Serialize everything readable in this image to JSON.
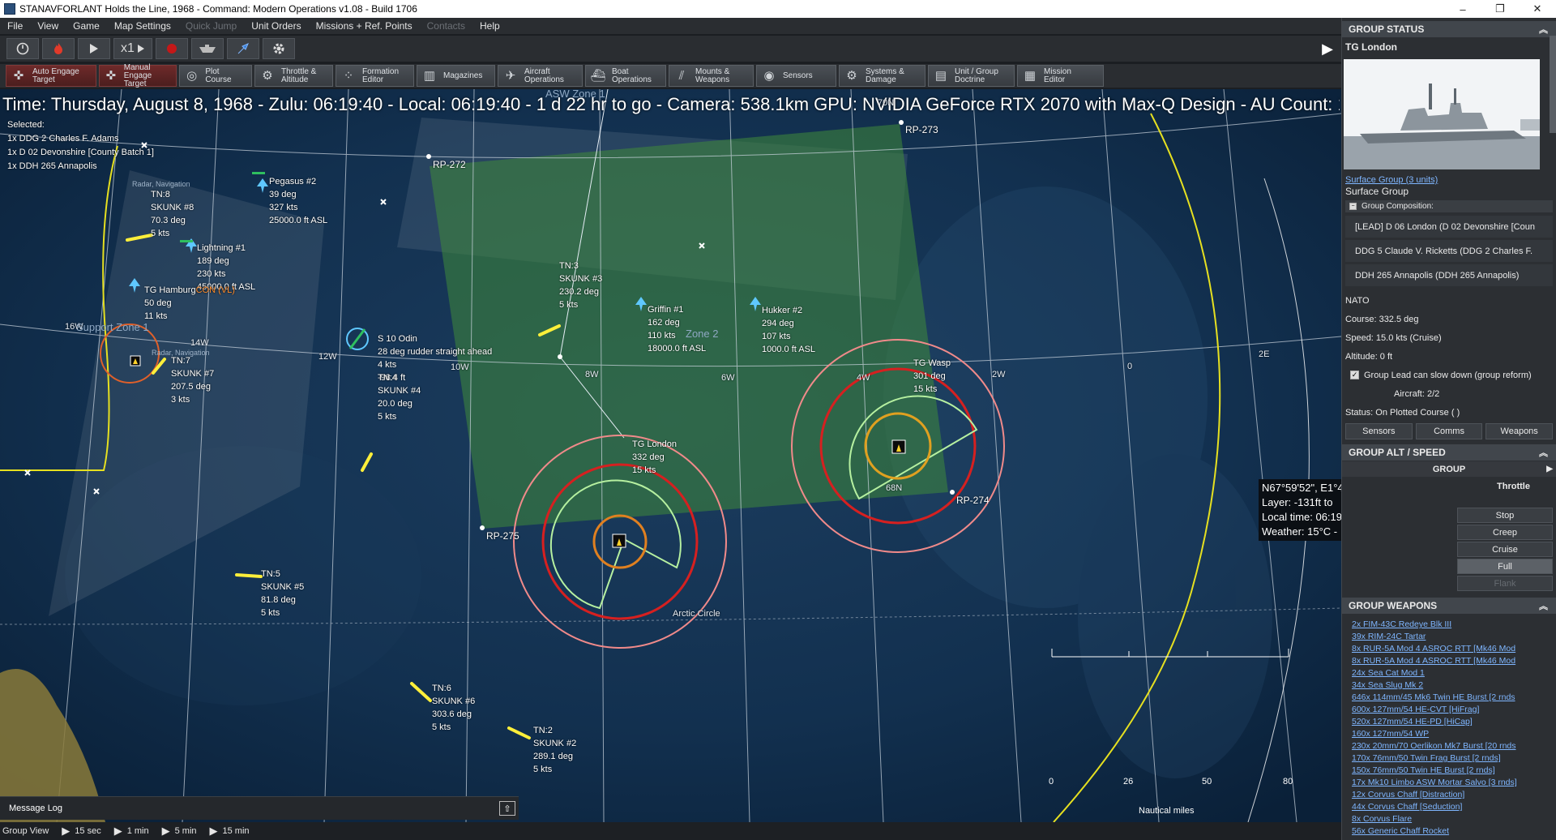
{
  "window": {
    "title": "STANAVFORLANT Holds the Line, 1968 - Command: Modern Operations v1.08 - Build 1706",
    "minimize": "–",
    "maximize": "❐",
    "close": "✕"
  },
  "menu": [
    {
      "label": "File",
      "enabled": true
    },
    {
      "label": "View",
      "enabled": true
    },
    {
      "label": "Game",
      "enabled": true
    },
    {
      "label": "Map Settings",
      "enabled": true
    },
    {
      "label": "Quick Jump",
      "enabled": false
    },
    {
      "label": "Unit Orders",
      "enabled": true
    },
    {
      "label": "Missions + Ref. Points",
      "enabled": true
    },
    {
      "label": "Contacts",
      "enabled": false
    },
    {
      "label": "Help",
      "enabled": true
    }
  ],
  "toolbar1": {
    "speed_label": "x1"
  },
  "toolbar2": [
    {
      "label": "Auto Engage\nTarget",
      "icon": "crosshair-icon",
      "red": true
    },
    {
      "label": "Manual\nEngage Target",
      "icon": "crosshair-icon",
      "red": true
    },
    {
      "label": "Plot Course",
      "icon": "course-icon",
      "red": false
    },
    {
      "label": "Throttle &\nAltitude",
      "icon": "throttle-icon",
      "red": false
    },
    {
      "label": "Formation\nEditor",
      "icon": "formation-icon",
      "red": false
    },
    {
      "label": "Magazines",
      "icon": "magazine-icon",
      "red": false
    },
    {
      "label": "Aircraft\nOperations",
      "icon": "aircraft-icon",
      "red": false
    },
    {
      "label": "Boat\nOperations",
      "icon": "boat-icon",
      "red": false
    },
    {
      "label": "Mounts &\nWeapons",
      "icon": "weapons-icon",
      "red": false
    },
    {
      "label": "Sensors",
      "icon": "sensor-icon",
      "red": false
    },
    {
      "label": "Systems &\nDamage",
      "icon": "systems-icon",
      "red": false
    },
    {
      "label": "Unit / Group\nDoctrine",
      "icon": "doctrine-icon",
      "red": false
    },
    {
      "label": "Mission\nEditor",
      "icon": "mission-icon",
      "red": false
    }
  ],
  "map": {
    "hud_time": "Time: Thursday, August 8, 1968 - Zulu: 06:19:40 - Local: 06:19:40 - 1 d 22 hr to go - Camera: 538.1km GPU: NVIDIA GeForce RTX 2070 with Max-Q Design - AU Count: 1",
    "selected_title": "Selected:",
    "selected": [
      "1x DDG 2 Charles F. Adams",
      "1x D 02 Devonshire [County Batch 1]",
      "1x DDH 265 Annapolis"
    ],
    "grid_labels": {
      "n70": "70N",
      "n68": "68N",
      "w16": "16W",
      "w14": "14W",
      "w12": "12W",
      "w10": "10W",
      "w8": "8W",
      "w6": "6W",
      "w4": "4W",
      "w2": "2W",
      "zero": "0",
      "e2": "2E",
      "arctic": "Arctic Circle"
    },
    "zones": {
      "support": "Support Zone 1",
      "asw": "ASW Zone 1",
      "zone2": "Zone 2"
    },
    "ref_points": [
      "RP-272",
      "RP-273",
      "RP-274",
      "RP-275"
    ],
    "units": [
      {
        "id": "tn8",
        "tag": "Radar, Navigation",
        "lines": [
          "TN:8",
          "SKUNK #8",
          "70.3 deg",
          "5 kts"
        ]
      },
      {
        "id": "pegasus",
        "lines": [
          "Pegasus #2",
          "39 deg",
          "327 kts",
          "25000.0 ft ASL"
        ]
      },
      {
        "id": "lightning",
        "lines": [
          "Lightning #1",
          "189 deg",
          "230 kts",
          "45000.0 ft ASL"
        ]
      },
      {
        "id": "hamburg",
        "lines": [
          "TG Hamburg",
          "50 deg",
          "11 kts"
        ],
        "extra": "CON (VL)"
      },
      {
        "id": "tn7",
        "tag": "Radar, Navigation",
        "lines": [
          "TN:7",
          "SKUNK #7",
          "207.5 deg",
          "3 kts"
        ]
      },
      {
        "id": "odin",
        "lines": [
          "S 10 Odin",
          "28 deg  rudder straight ahead",
          "4 kts",
          "-98.4 ft"
        ]
      },
      {
        "id": "tn4",
        "lines": [
          "TN:4",
          "SKUNK #4",
          "20.0 deg",
          "5 kts"
        ]
      },
      {
        "id": "tn3",
        "lines": [
          "TN:3",
          "SKUNK #3",
          "230.2 deg",
          "5 kts"
        ]
      },
      {
        "id": "griffin",
        "lines": [
          "Griffin #1",
          "162 deg",
          "110 kts",
          "18000.0 ft ASL"
        ]
      },
      {
        "id": "hukker",
        "lines": [
          "Hukker #2",
          "294 deg",
          "107 kts",
          "1000.0 ft ASL"
        ]
      },
      {
        "id": "wasp",
        "lines": [
          "TG Wasp",
          "301 deg",
          "15 kts"
        ]
      },
      {
        "id": "london",
        "lines": [
          "TG London",
          "332 deg",
          "15 kts"
        ]
      },
      {
        "id": "tn5",
        "lines": [
          "TN:5",
          "SKUNK #5",
          "81.8 deg",
          "5 kts"
        ]
      },
      {
        "id": "tn6",
        "lines": [
          "TN:6",
          "SKUNK #6",
          "303.6 deg",
          "5 kts"
        ]
      },
      {
        "id": "tn2",
        "lines": [
          "TN:2",
          "SKUNK #2",
          "289.1 deg",
          "5 kts"
        ]
      }
    ],
    "info_box": [
      "N67°59'52\", E1°4",
      "Layer: -131ft to",
      "Local time: 06:19",
      "Weather: 15°C -"
    ],
    "scale": {
      "ticks": [
        "0",
        "26",
        "50",
        "80"
      ],
      "unit": "Nautical miles"
    }
  },
  "message_log": {
    "label": "Message Log",
    "expand": "⇧"
  },
  "status_bar": {
    "group_view": "Group View",
    "steps": [
      "15 sec",
      "1 min",
      "5 min",
      "15 min"
    ]
  },
  "panel": {
    "group_status": {
      "header": "GROUP STATUS",
      "name": "TG London",
      "group_link": "Surface Group (3 units)",
      "group_type": "Surface Group",
      "composition_label": "Group Composition:",
      "composition": [
        "[LEAD] D 06 London (D 02 Devonshire [Coun",
        "DDG 5 Claude V. Ricketts (DDG 2 Charles F.",
        "DDH 265 Annapolis (DDH 265 Annapolis)"
      ],
      "side": "NATO",
      "course": "Course: 332.5 deg",
      "speed": "Speed: 15.0 kts (Cruise)",
      "altitude": "Altitude: 0 ft",
      "group_lead": "Group Lead can slow down (group reform)",
      "aircraft": "Aircraft: 2/2",
      "status": "Status: On Plotted Course ( )",
      "buttons": [
        "Sensors",
        "Comms",
        "Weapons"
      ]
    },
    "alt_speed": {
      "header": "GROUP ALT / SPEED",
      "group_label": "GROUP",
      "throttle_label": "Throttle",
      "speeds": [
        "Stop",
        "Creep",
        "Cruise",
        "Full",
        "Flank"
      ],
      "selected_speed": "Full"
    },
    "weapons": {
      "header": "GROUP WEAPONS",
      "items": [
        "2x FIM-43C Redeye Blk III",
        "39x RIM-24C Tartar",
        "8x RUR-5A Mod 4 ASROC RTT [Mk46 Mod",
        "8x RUR-5A Mod 4 ASROC RTT [Mk46 Mod",
        "24x Sea Cat Mod 1",
        "34x Sea Slug Mk 2",
        "646x 114mm/45 Mk6 Twin HE Burst [2 rnds",
        "600x 127mm/54 HE-CVT [HiFrag]",
        "520x 127mm/54 HE-PD [HiCap]",
        "160x 127mm/54 WP",
        "230x 20mm/70 Oerlikon Mk7 Burst [20 rnds",
        "170x 76mm/50 Twin Frag Burst [2 rnds]",
        "150x 76mm/50 Twin HE Burst [2 rnds]",
        "17x Mk10 Limbo ASW Mortar Salvo [3 rnds]",
        "12x Corvus Chaff [Distraction]",
        "44x Corvus Chaff [Seduction]",
        "8x Corvus Flare",
        "56x Generic Chaff Rocket"
      ]
    }
  },
  "colors": {
    "ocean": "#0f2a48",
    "zone_green": "#3f8a3a",
    "range_red": "#d62020",
    "range_pink": "#f08a8a",
    "sensor_green": "#9de08a",
    "link_blue": "#7fb6ff"
  }
}
